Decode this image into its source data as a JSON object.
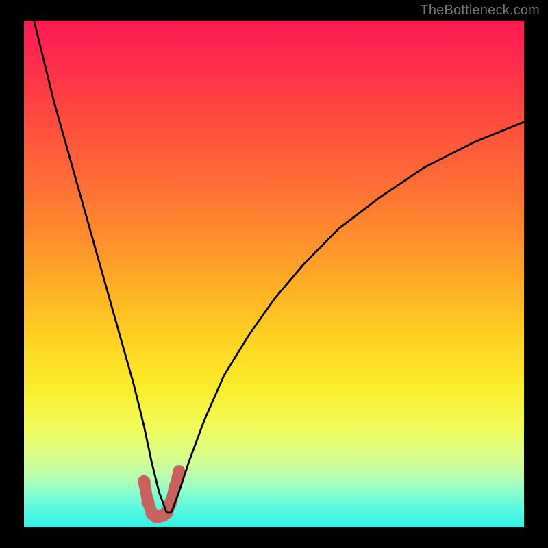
{
  "attribution": "TheBottleneck.com",
  "chart_data": {
    "type": "line",
    "title": "",
    "xlabel": "",
    "ylabel": "",
    "xlim": [
      0,
      100
    ],
    "ylim": [
      0,
      100
    ],
    "gradient_stops": [
      {
        "pos": 0,
        "color": "#ff1a52"
      },
      {
        "pos": 8,
        "color": "#ff2b4d"
      },
      {
        "pos": 18,
        "color": "#ff4740"
      },
      {
        "pos": 30,
        "color": "#ff6837"
      },
      {
        "pos": 42,
        "color": "#ff8b2e"
      },
      {
        "pos": 52,
        "color": "#ffad26"
      },
      {
        "pos": 62,
        "color": "#ffd021"
      },
      {
        "pos": 72,
        "color": "#fbec2a"
      },
      {
        "pos": 80,
        "color": "#f1fb58"
      },
      {
        "pos": 86,
        "color": "#d9fe8b"
      },
      {
        "pos": 90,
        "color": "#b7feaf"
      },
      {
        "pos": 93,
        "color": "#8bfecb"
      },
      {
        "pos": 96,
        "color": "#5bfadf"
      },
      {
        "pos": 100,
        "color": "#2ff0e6"
      }
    ],
    "series": [
      {
        "name": "bottleneck-curve",
        "color": "#000000",
        "stroke_width": 2.8,
        "x": [
          2,
          4,
          6,
          8,
          10,
          12,
          14,
          16,
          18,
          20,
          22,
          24,
          25.5,
          27,
          28.5,
          29.5,
          31,
          33,
          36,
          40,
          45,
          50,
          56,
          63,
          71,
          80,
          90,
          100
        ],
        "y": [
          100,
          92,
          84,
          77,
          70,
          63,
          56,
          49,
          42,
          35,
          28,
          20,
          13,
          7,
          3,
          3,
          7,
          13,
          21,
          30,
          38,
          45,
          52,
          59,
          65,
          71,
          76,
          80
        ]
      }
    ],
    "highlight_band": {
      "name": "valley-highlight",
      "color": "#c9615f",
      "stroke_width": 17,
      "x": [
        24.0,
        24.8,
        25.6,
        26.3,
        27.0,
        27.8,
        28.6,
        29.4,
        30.2,
        31.0
      ],
      "y": [
        9.0,
        5.0,
        2.8,
        2.2,
        2.2,
        2.4,
        3.0,
        5.0,
        8.0,
        11.0
      ]
    }
  }
}
